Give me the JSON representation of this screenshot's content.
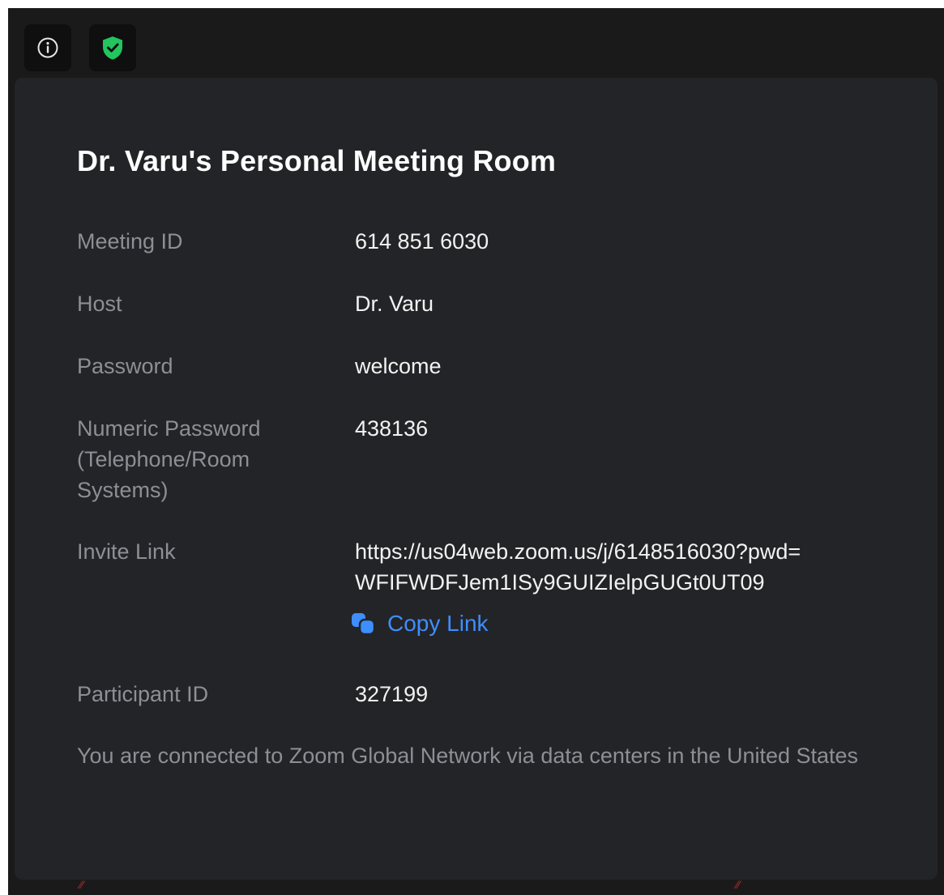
{
  "toolbar": {
    "info_icon": "info-icon",
    "shield_icon": "shield-check-icon",
    "shield_color": "#22c55e"
  },
  "panel": {
    "title": "Dr. Varu's Personal Meeting Room",
    "rows": [
      {
        "label": "Meeting ID",
        "value": "614 851 6030"
      },
      {
        "label": "Host",
        "value": "Dr. Varu"
      },
      {
        "label": "Password",
        "value": "welcome"
      },
      {
        "label": "Numeric Password (Telephone/Room Systems)",
        "value": "438136"
      },
      {
        "label": "Invite Link",
        "value_line1": "https://us04web.zoom.us/j/6148516030?pwd=",
        "value_line2": "WFIFWDFJem1ISy9GUIZIelpGUGt0UT09"
      },
      {
        "label": "Participant ID",
        "value": "327199"
      }
    ],
    "copy_link_label": "Copy Link",
    "copy_link_color": "#3e8eff",
    "footer": "You are connected to Zoom Global Network via data centers in the United States"
  },
  "colors": {
    "background": "#1a1a1a",
    "panel": "#232427",
    "label": "#8d8f94",
    "value": "#f2f2f2"
  }
}
